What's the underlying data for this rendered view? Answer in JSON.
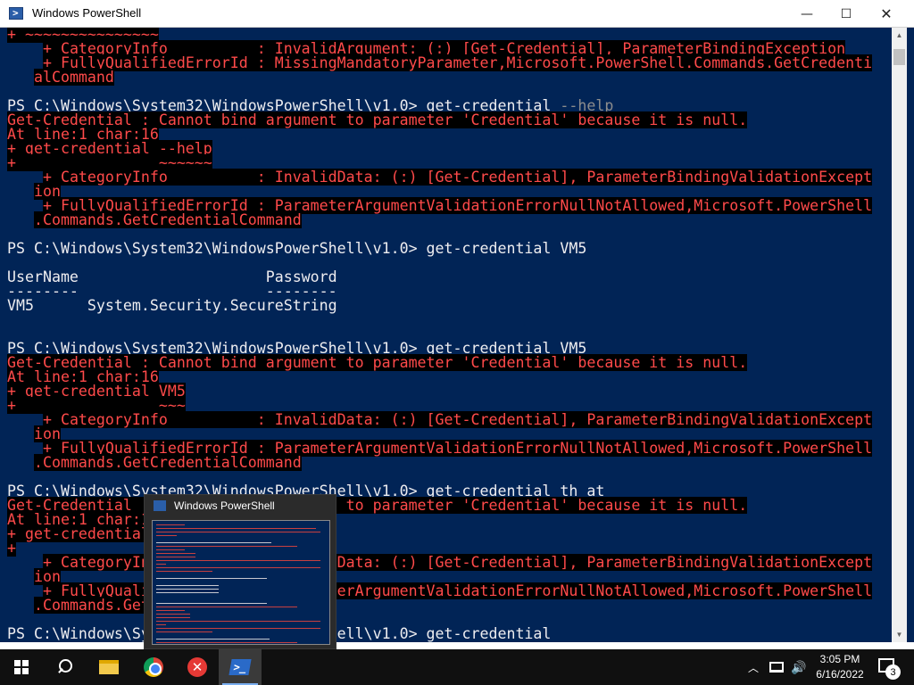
{
  "window": {
    "title": "Windows PowerShell",
    "controls": {
      "minimize": "—",
      "maximize": "☐",
      "close": "✕"
    }
  },
  "console": {
    "lines": [
      [
        [
          "e",
          "+ ~~~~~~~~~~~~~~~"
        ]
      ],
      [
        [
          "n",
          "    "
        ],
        [
          "e",
          "+ CategoryInfo          : InvalidArgument: (:) [Get-Credential], ParameterBindingException"
        ]
      ],
      [
        [
          "n",
          "    "
        ],
        [
          "e",
          "+ FullyQualifiedErrorId : MissingMandatoryParameter,Microsoft.PowerShell.Commands.GetCredenti"
        ]
      ],
      [
        [
          "n",
          "   "
        ],
        [
          "e",
          "alCommand"
        ]
      ],
      [
        [
          "n",
          ""
        ]
      ],
      [
        [
          "n",
          "PS C:\\Windows\\System32\\WindowsPowerShell\\v1.0> get-credential "
        ],
        [
          "g",
          "--help"
        ]
      ],
      [
        [
          "e",
          "Get-Credential : Cannot bind argument to parameter 'Credential' because it is null."
        ]
      ],
      [
        [
          "e",
          "At line:1 char:16"
        ]
      ],
      [
        [
          "e",
          "+ get-credential --help"
        ]
      ],
      [
        [
          "e",
          "+                ~~~~~~"
        ]
      ],
      [
        [
          "n",
          "    "
        ],
        [
          "e",
          "+ CategoryInfo          : InvalidData: (:) [Get-Credential], ParameterBindingValidationExcept"
        ]
      ],
      [
        [
          "n",
          "   "
        ],
        [
          "e",
          "ion"
        ]
      ],
      [
        [
          "n",
          "    "
        ],
        [
          "e",
          "+ FullyQualifiedErrorId : ParameterArgumentValidationErrorNullNotAllowed,Microsoft.PowerShell"
        ]
      ],
      [
        [
          "n",
          "   "
        ],
        [
          "e",
          ".Commands.GetCredentialCommand"
        ]
      ],
      [
        [
          "n",
          ""
        ]
      ],
      [
        [
          "n",
          "PS C:\\Windows\\System32\\WindowsPowerShell\\v1.0> get-credential VM5"
        ]
      ],
      [
        [
          "n",
          ""
        ]
      ],
      [
        [
          "n",
          "UserName                     Password"
        ]
      ],
      [
        [
          "n",
          "--------                     --------"
        ]
      ],
      [
        [
          "n",
          "VM5      System.Security.SecureString"
        ]
      ],
      [
        [
          "n",
          ""
        ]
      ],
      [
        [
          "n",
          ""
        ]
      ],
      [
        [
          "n",
          "PS C:\\Windows\\System32\\WindowsPowerShell\\v1.0> get-credential VM5"
        ]
      ],
      [
        [
          "e",
          "Get-Credential : Cannot bind argument to parameter 'Credential' because it is null."
        ]
      ],
      [
        [
          "e",
          "At line:1 char:16"
        ]
      ],
      [
        [
          "e",
          "+ get-credential VM5"
        ]
      ],
      [
        [
          "e",
          "+                ~~~"
        ]
      ],
      [
        [
          "n",
          "    "
        ],
        [
          "e",
          "+ CategoryInfo          : InvalidData: (:) [Get-Credential], ParameterBindingValidationExcept"
        ]
      ],
      [
        [
          "n",
          "   "
        ],
        [
          "e",
          "ion"
        ]
      ],
      [
        [
          "n",
          "    "
        ],
        [
          "e",
          "+ FullyQualifiedErrorId : ParameterArgumentValidationErrorNullNotAllowed,Microsoft.PowerShell"
        ]
      ],
      [
        [
          "n",
          "   "
        ],
        [
          "e",
          ".Commands.GetCredentialCommand"
        ]
      ],
      [
        [
          "n",
          ""
        ]
      ],
      [
        [
          "n",
          "PS C:\\Windows\\System32\\WindowsPowerShell\\v1.0> get-credential th at"
        ]
      ],
      [
        [
          "e",
          "Get-Credential : Cannot bind argument to parameter 'Credential' because it is null."
        ]
      ],
      [
        [
          "e",
          "At line:1 char:16"
        ]
      ],
      [
        [
          "e",
          "+ get-credential th at"
        ]
      ],
      [
        [
          "e",
          "+"
        ]
      ],
      [
        [
          "n",
          "    "
        ],
        [
          "e",
          "+ CategoryInfo          : InvalidData: (:) [Get-Credential], ParameterBindingValidationExcept"
        ]
      ],
      [
        [
          "n",
          "   "
        ],
        [
          "e",
          "ion"
        ]
      ],
      [
        [
          "n",
          "    "
        ],
        [
          "e",
          "+ FullyQualifiedErrorId : ParameterArgumentValidationErrorNullNotAllowed,Microsoft.PowerShell"
        ]
      ],
      [
        [
          "n",
          "   "
        ],
        [
          "e",
          ".Commands.GetCredentialCommand"
        ]
      ],
      [
        [
          "n",
          ""
        ]
      ],
      [
        [
          "n",
          "PS C:\\Windows\\System32\\WindowsPowerShell\\v1.0> get-credential"
        ]
      ]
    ],
    "colors": {
      "background": "#012456",
      "text": "#eeedf0",
      "error_text": "#ff4a4a",
      "error_background": "#000000"
    }
  },
  "preview": {
    "title": "Windows PowerShell"
  },
  "taskbar": {
    "items": [
      {
        "name": "start-button",
        "icon": "windows-start-icon"
      },
      {
        "name": "search-button",
        "icon": "search-icon"
      },
      {
        "name": "file-explorer-button",
        "icon": "folder-icon"
      },
      {
        "name": "chrome-button",
        "icon": "chrome-icon"
      },
      {
        "name": "app-x-button",
        "icon": "red-x-icon"
      },
      {
        "name": "powershell-button",
        "icon": "powershell-icon",
        "active": true
      }
    ],
    "tray": {
      "chevron": "︿",
      "volume": "🔊",
      "time": "3:05 PM",
      "date": "6/16/2022",
      "notification_count": "3"
    }
  }
}
